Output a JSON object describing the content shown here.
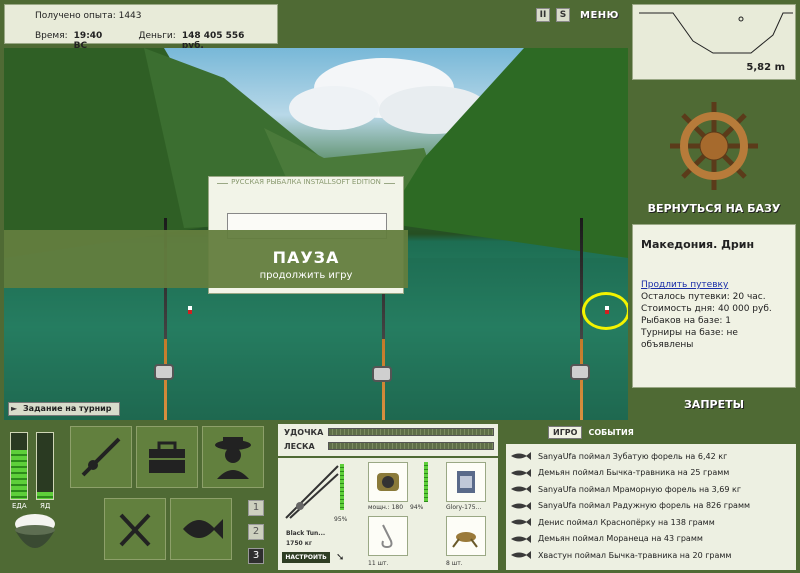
{
  "stats": {
    "exp_label": "Получено опыта: 1443",
    "time_label": "Время:",
    "time_value": "19:40 ВС",
    "money_label": "Деньги:",
    "money_value": "148 405 556 руб."
  },
  "top_controls": {
    "pause_glyph": "II",
    "sound_glyph": "S",
    "menu_label": "МЕНЮ"
  },
  "depth": {
    "value": "5,82 m"
  },
  "scene": {
    "pause_box_title": "РУССКАЯ РЫБАЛКА INSTALLSOFT EDITION",
    "pause_label": "ПАУЗА",
    "continue_label": "продолжить игру",
    "tournament_label": "Задание на турнир"
  },
  "base": {
    "back_label": "ВЕРНУТЬСЯ НА БАЗУ",
    "location": "Македония. Дрин",
    "extend_link": "Продлить путевку",
    "lines": [
      "Осталось путевки: 20 час.",
      "Стоимость дня: 40 000 руб.",
      "Рыбаков на базе: 1",
      "Турниры на базе: не объявлены"
    ],
    "bans_label": "ЗАПРЕТЫ"
  },
  "meters": {
    "food_label": "ЕДА",
    "poison_label": "ЯД",
    "food_level": 0.75,
    "poison_level": 0.1
  },
  "num_buttons": [
    "1",
    "2",
    "3"
  ],
  "tackle": {
    "rod_label": "УДОЧКА",
    "line_label": "ЛЕСКА",
    "rod_name": "Black Tun...",
    "rod_weight": "1750 кг",
    "rod_percent": "95%",
    "setup_label": "НАСТРОИТЬ",
    "reel_label": "мощн.: 180",
    "reel_percent": "94%",
    "line_item_label": "Glory-175...",
    "hook_count": "11 шт.",
    "bait_count": "8 шт."
  },
  "events": {
    "tab_game": "ИГРО",
    "tab_events": "СОБЫТИЯ",
    "items": [
      "SanyaUfa поймал Зубатую форель на 6,42 кг",
      "Демьян поймал Бычка-травника на 25 грамм",
      "SanyaUfa поймал Мраморную форель на 3,69 кг",
      "SanyaUfa поймал Радужную форель на 826 грамм",
      "Денис поймал Краснопёрку на 138 грамм",
      "Демьян поймал Моранеца на 43 грамм",
      "Хвастун поймал Бычка-травника на 20 грамм"
    ]
  },
  "colors": {
    "panel_green": "#4f6a34",
    "panel_light": "#edf0e2",
    "highlight": "#f3f300",
    "link": "#1a2ea8"
  }
}
